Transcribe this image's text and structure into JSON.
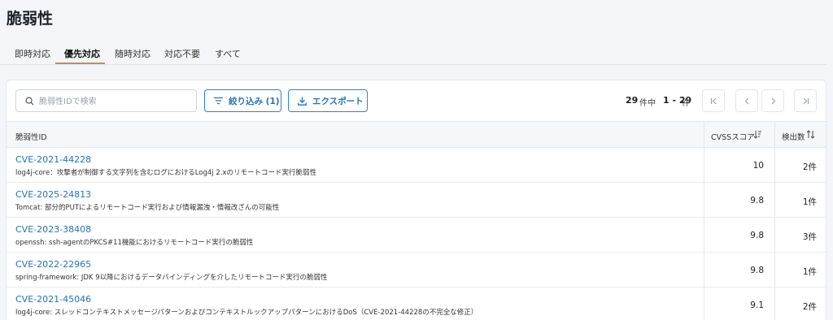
{
  "page": {
    "title": "脆弱性"
  },
  "tabs": [
    {
      "label": "即時対応"
    },
    {
      "label": "優先対応",
      "active": true
    },
    {
      "label": "随時対応"
    },
    {
      "label": "対応不要"
    },
    {
      "label": "すべて"
    }
  ],
  "toolbar": {
    "search_placeholder": "脆弱性IDで検索",
    "filter_label": "絞り込み (1)",
    "export_label": "エクスポート"
  },
  "pagination": {
    "total": "29",
    "total_unit": "件中",
    "range": "1 - 29",
    "range_unit": "件"
  },
  "table": {
    "columns": {
      "id": "脆弱性ID",
      "score": "CVSSスコア",
      "count": "検出数"
    },
    "rows": [
      {
        "id": "CVE-2021-44228",
        "desc": "log4j-core：攻撃者が制御する文字列を含むログにおけるLog4j 2.xのリモートコード実行脆弱性",
        "score": "10",
        "count": "2件"
      },
      {
        "id": "CVE-2025-24813",
        "desc": "Tomcat: 部分的PUTによるリモートコード実行および情報漏洩・情報改ざんの可能性",
        "score": "9.8",
        "count": "1件"
      },
      {
        "id": "CVE-2023-38408",
        "desc": "openssh: ssh-agentのPKCS#11機能におけるリモートコード実行の脆弱性",
        "score": "9.8",
        "count": "3件"
      },
      {
        "id": "CVE-2022-22965",
        "desc": "spring-framework: JDK 9以降におけるデータバインディングを介したリモートコード実行の脆弱性",
        "score": "9.8",
        "count": "1件"
      },
      {
        "id": "CVE-2021-45046",
        "desc": "log4j-core: スレッドコンテキストメッセージパターンおよびコンテキストルックアップパターンにおけるDoS（CVE-2021-44228の不完全な修正）",
        "score": "9.1",
        "count": "2件"
      }
    ]
  },
  "colors": {
    "accent": "#2673b4",
    "tab_underline": "#c98b4a"
  },
  "icons": {
    "search": "search-icon",
    "filter": "filter-icon",
    "export": "download-icon",
    "first": "first-page-icon",
    "prev": "chevron-left-icon",
    "next": "chevron-right-icon",
    "last": "last-page-icon",
    "sort_desc": "sort-desc-icon",
    "sort_both": "sort-both-icon"
  }
}
